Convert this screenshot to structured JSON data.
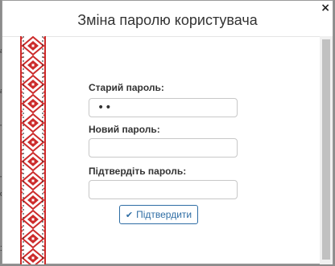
{
  "dialog": {
    "title": "Зміна паролю користувача",
    "close_glyph": "×",
    "fields": [
      {
        "label": "Старий пароль:",
        "value": "••",
        "placeholder": ""
      },
      {
        "label": "Новий пароль:",
        "value": "",
        "placeholder": ""
      },
      {
        "label": "Підтвердіть пароль:",
        "value": "",
        "placeholder": ""
      }
    ],
    "confirm_label": "Підтвердити",
    "confirm_icon": "check-icon"
  },
  "backdrop_snippets": [
    "a",
    "a",
    "T",
    "T",
    "c",
    "1"
  ],
  "colors": {
    "accent": "#2e6da4",
    "pattern_red": "#cc2b2b",
    "overlay": "#8c8c8c"
  }
}
